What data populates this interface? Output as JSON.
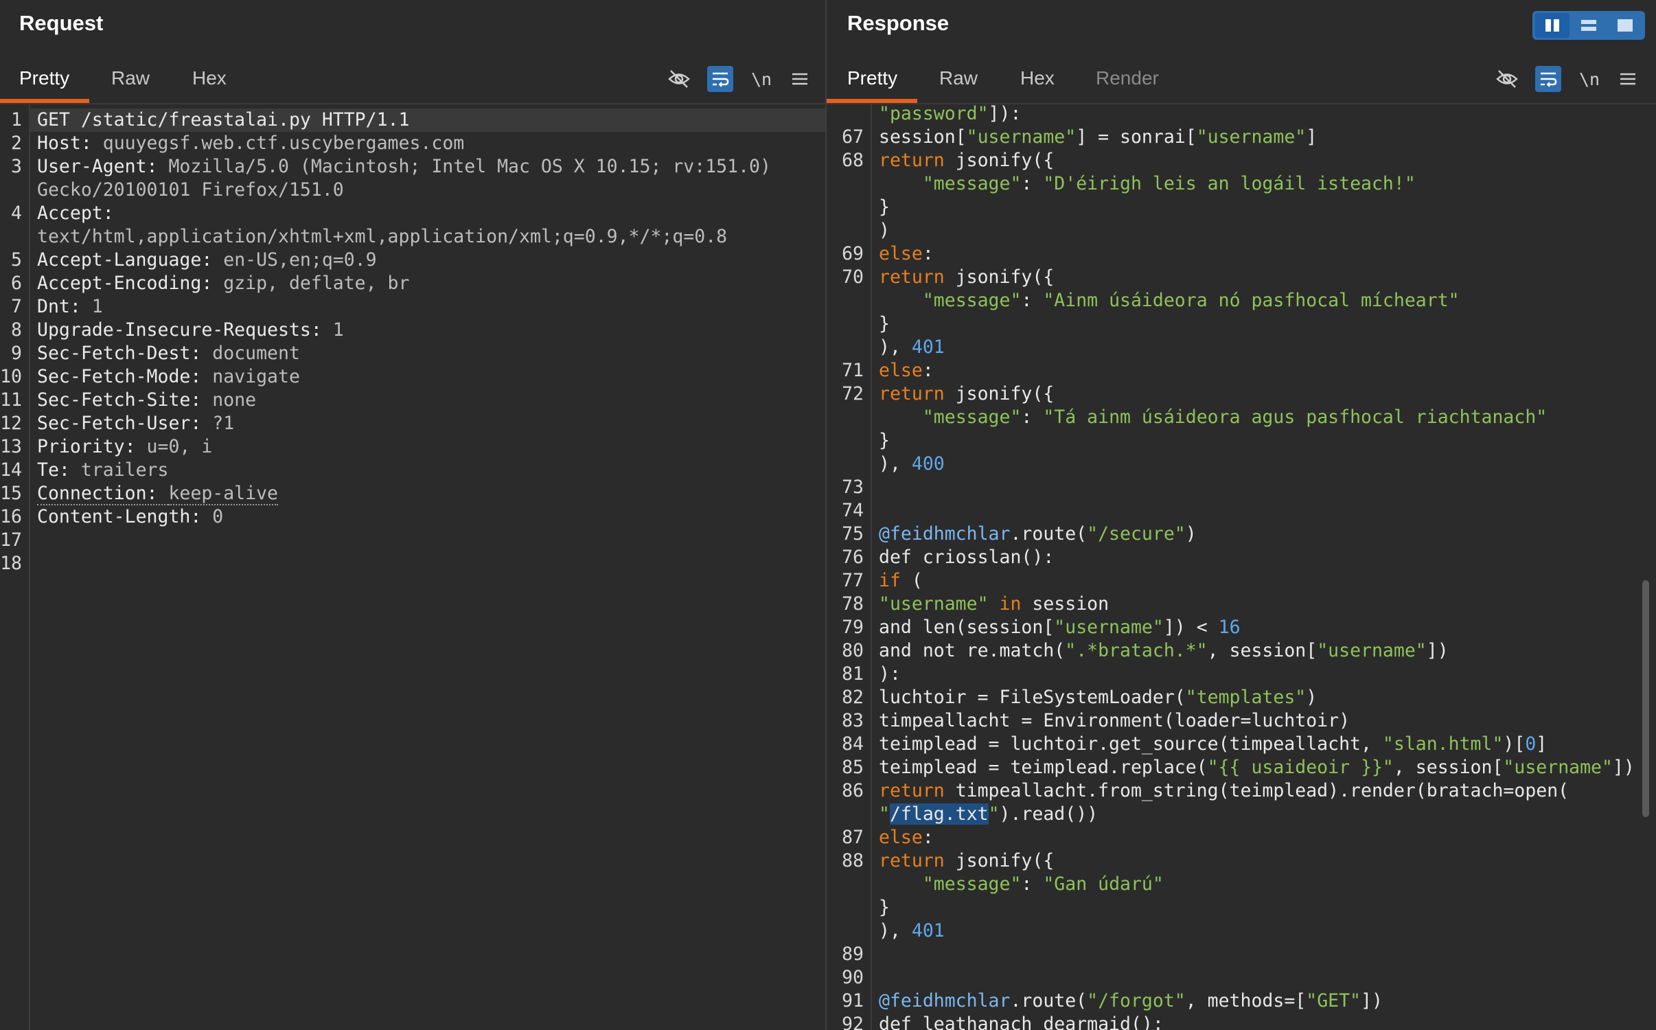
{
  "request": {
    "title": "Request",
    "tabs": [
      "Pretty",
      "Raw",
      "Hex"
    ],
    "active_tab": "Pretty",
    "lines": [
      {
        "n": "1",
        "parts": [
          [
            "plain",
            "GET /static/freastalai.py HTTP/1.1"
          ]
        ]
      },
      {
        "n": "2",
        "parts": [
          [
            "hname",
            "Host: "
          ],
          [
            "hval",
            "quuyegsf.web.ctf.uscybergames.com"
          ]
        ]
      },
      {
        "n": "3",
        "parts": [
          [
            "hname",
            "User-Agent: "
          ],
          [
            "hval",
            "Mozilla/5.0 (Macintosh; Intel Mac OS X 10.15; rv:151.0)"
          ]
        ]
      },
      {
        "n": "",
        "parts": [
          [
            "hval",
            "Gecko/20100101 Firefox/151.0"
          ]
        ]
      },
      {
        "n": "4",
        "parts": [
          [
            "hname",
            "Accept:"
          ]
        ]
      },
      {
        "n": "",
        "parts": [
          [
            "hval",
            "text/html,application/xhtml+xml,application/xml;q=0.9,*/*;q=0.8"
          ]
        ]
      },
      {
        "n": "5",
        "parts": [
          [
            "hname",
            "Accept-Language: "
          ],
          [
            "hval",
            "en-US,en;q=0.9"
          ]
        ]
      },
      {
        "n": "6",
        "parts": [
          [
            "hname",
            "Accept-Encoding: "
          ],
          [
            "hval",
            "gzip, deflate, br"
          ]
        ]
      },
      {
        "n": "7",
        "parts": [
          [
            "hname",
            "Dnt: "
          ],
          [
            "hval",
            "1"
          ]
        ]
      },
      {
        "n": "8",
        "parts": [
          [
            "hname",
            "Upgrade-Insecure-Requests: "
          ],
          [
            "hval",
            "1"
          ]
        ]
      },
      {
        "n": "9",
        "parts": [
          [
            "hname",
            "Sec-Fetch-Dest: "
          ],
          [
            "hval",
            "document"
          ]
        ]
      },
      {
        "n": "10",
        "parts": [
          [
            "hname",
            "Sec-Fetch-Mode: "
          ],
          [
            "hval",
            "navigate"
          ]
        ]
      },
      {
        "n": "11",
        "parts": [
          [
            "hname",
            "Sec-Fetch-Site: "
          ],
          [
            "hval",
            "none"
          ]
        ]
      },
      {
        "n": "12",
        "parts": [
          [
            "hname",
            "Sec-Fetch-User: "
          ],
          [
            "hval",
            "?1"
          ]
        ]
      },
      {
        "n": "13",
        "parts": [
          [
            "hname",
            "Priority: "
          ],
          [
            "hval",
            "u=0, i"
          ]
        ]
      },
      {
        "n": "14",
        "parts": [
          [
            "hname",
            "Te: "
          ],
          [
            "hval",
            "trailers"
          ]
        ]
      },
      {
        "n": "15",
        "parts": [
          [
            "hname ul",
            "Connection: "
          ],
          [
            "hval ul",
            "keep-alive"
          ]
        ]
      },
      {
        "n": "16",
        "parts": [
          [
            "hname",
            "Content-Length: "
          ],
          [
            "hval",
            "0"
          ]
        ]
      },
      {
        "n": "17",
        "parts": []
      },
      {
        "n": "18",
        "parts": []
      }
    ]
  },
  "response": {
    "title": "Response",
    "tabs": [
      "Pretty",
      "Raw",
      "Hex",
      "Render"
    ],
    "active_tab": "Pretty",
    "lines": [
      {
        "n": "",
        "parts": [
          [
            "str",
            "\"password\""
          ],
          [
            "plain",
            "]):"
          ]
        ]
      },
      {
        "n": "67",
        "parts": [
          [
            "plain",
            "session["
          ],
          [
            "str",
            "\"username\""
          ],
          [
            "plain",
            "] = sonrai["
          ],
          [
            "str",
            "\"username\""
          ],
          [
            "plain",
            "]"
          ]
        ]
      },
      {
        "n": "68",
        "parts": [
          [
            "kw",
            "return"
          ],
          [
            "plain",
            " jsonify({"
          ]
        ]
      },
      {
        "n": "",
        "parts": [
          [
            "plain",
            "    "
          ],
          [
            "str",
            "\"message\""
          ],
          [
            "plain",
            ": "
          ],
          [
            "str",
            "\"D'éirigh leis an logáil isteach!\""
          ]
        ]
      },
      {
        "n": "",
        "parts": [
          [
            "plain",
            "}"
          ]
        ]
      },
      {
        "n": "",
        "parts": [
          [
            "plain",
            ")"
          ]
        ]
      },
      {
        "n": "69",
        "parts": [
          [
            "kw",
            "else"
          ],
          [
            "plain",
            ":"
          ]
        ]
      },
      {
        "n": "70",
        "parts": [
          [
            "kw",
            "return"
          ],
          [
            "plain",
            " jsonify({"
          ]
        ]
      },
      {
        "n": "",
        "parts": [
          [
            "plain",
            "    "
          ],
          [
            "str",
            "\"message\""
          ],
          [
            "plain",
            ": "
          ],
          [
            "str",
            "\"Ainm úsáideora nó pasfhocal mícheart\""
          ]
        ]
      },
      {
        "n": "",
        "parts": [
          [
            "plain",
            "}"
          ]
        ]
      },
      {
        "n": "",
        "parts": [
          [
            "plain",
            "), "
          ],
          [
            "num",
            "401"
          ]
        ]
      },
      {
        "n": "71",
        "parts": [
          [
            "kw",
            "else"
          ],
          [
            "plain",
            ":"
          ]
        ]
      },
      {
        "n": "72",
        "parts": [
          [
            "kw",
            "return"
          ],
          [
            "plain",
            " jsonify({"
          ]
        ]
      },
      {
        "n": "",
        "parts": [
          [
            "plain",
            "    "
          ],
          [
            "str",
            "\"message\""
          ],
          [
            "plain",
            ": "
          ],
          [
            "str",
            "\"Tá ainm úsáideora agus pasfhocal riachtanach\""
          ]
        ]
      },
      {
        "n": "",
        "parts": [
          [
            "plain",
            "}"
          ]
        ]
      },
      {
        "n": "",
        "parts": [
          [
            "plain",
            "), "
          ],
          [
            "num",
            "400"
          ]
        ]
      },
      {
        "n": "73",
        "parts": []
      },
      {
        "n": "74",
        "parts": []
      },
      {
        "n": "75",
        "parts": [
          [
            "dec",
            "@feidhmchlar"
          ],
          [
            "plain",
            ".route("
          ],
          [
            "str",
            "\"/secure\""
          ],
          [
            "plain",
            ")"
          ]
        ]
      },
      {
        "n": "76",
        "parts": [
          [
            "plain",
            "def criosslan():"
          ]
        ]
      },
      {
        "n": "77",
        "parts": [
          [
            "kw",
            "if"
          ],
          [
            "plain",
            " ("
          ]
        ]
      },
      {
        "n": "78",
        "parts": [
          [
            "str",
            "\"username\""
          ],
          [
            "plain",
            " "
          ],
          [
            "kw",
            "in"
          ],
          [
            "plain",
            " session"
          ]
        ]
      },
      {
        "n": "79",
        "parts": [
          [
            "plain",
            "and len(session["
          ],
          [
            "str",
            "\"username\""
          ],
          [
            "plain",
            "]) < "
          ],
          [
            "num",
            "16"
          ]
        ]
      },
      {
        "n": "80",
        "parts": [
          [
            "plain",
            "and not re.match("
          ],
          [
            "str",
            "\".*bratach.*\""
          ],
          [
            "plain",
            ", session["
          ],
          [
            "str",
            "\"username\""
          ],
          [
            "plain",
            "])"
          ]
        ]
      },
      {
        "n": "81",
        "parts": [
          [
            "plain",
            "):"
          ]
        ]
      },
      {
        "n": "82",
        "parts": [
          [
            "plain",
            "luchtoir = FileSystemLoader("
          ],
          [
            "str",
            "\"templates\""
          ],
          [
            "plain",
            ")"
          ]
        ]
      },
      {
        "n": "83",
        "parts": [
          [
            "plain",
            "timpeallacht = Environment(loader=luchtoir)"
          ]
        ]
      },
      {
        "n": "84",
        "parts": [
          [
            "plain",
            "teimplead = luchtoir.get_source(timpeallacht, "
          ],
          [
            "str",
            "\"slan.html\""
          ],
          [
            "plain",
            ")["
          ],
          [
            "num",
            "0"
          ],
          [
            "plain",
            "]"
          ]
        ]
      },
      {
        "n": "85",
        "parts": [
          [
            "plain",
            "teimplead = teimplead.replace("
          ],
          [
            "str",
            "\"{{ usaideoir }}\""
          ],
          [
            "plain",
            ", session["
          ],
          [
            "str",
            "\"username\""
          ],
          [
            "plain",
            "])"
          ]
        ]
      },
      {
        "n": "86",
        "parts": [
          [
            "kw",
            "return"
          ],
          [
            "plain",
            " timpeallacht.from_string(teimplead).render(bratach=open("
          ]
        ]
      },
      {
        "n": "",
        "parts": [
          [
            "str",
            "\""
          ],
          [
            "sel",
            "/flag.txt"
          ],
          [
            "str",
            "\""
          ],
          [
            "plain",
            ").read())"
          ]
        ]
      },
      {
        "n": "87",
        "parts": [
          [
            "kw",
            "else"
          ],
          [
            "plain",
            ":"
          ]
        ]
      },
      {
        "n": "88",
        "parts": [
          [
            "kw",
            "return"
          ],
          [
            "plain",
            " jsonify({"
          ]
        ]
      },
      {
        "n": "",
        "parts": [
          [
            "plain",
            "    "
          ],
          [
            "str",
            "\"message\""
          ],
          [
            "plain",
            ": "
          ],
          [
            "str",
            "\"Gan údarú\""
          ]
        ]
      },
      {
        "n": "",
        "parts": [
          [
            "plain",
            "}"
          ]
        ]
      },
      {
        "n": "",
        "parts": [
          [
            "plain",
            "), "
          ],
          [
            "num",
            "401"
          ]
        ]
      },
      {
        "n": "89",
        "parts": []
      },
      {
        "n": "90",
        "parts": []
      },
      {
        "n": "91",
        "parts": [
          [
            "dec",
            "@feidhmchlar"
          ],
          [
            "plain",
            ".route("
          ],
          [
            "str",
            "\"/forgot\""
          ],
          [
            "plain",
            ", methods=["
          ],
          [
            "str",
            "\"GET\""
          ],
          [
            "plain",
            "])"
          ]
        ]
      },
      {
        "n": "92",
        "parts": [
          [
            "plain",
            "def leathanach_dearmaid():"
          ]
        ]
      }
    ]
  },
  "toolbar_icons": [
    "eye-slash-icon",
    "wrap-icon",
    "newline-toggle",
    "menu-icon"
  ],
  "newline_label": "\\n",
  "colors": {
    "accent": "#e8601c",
    "active_blue": "#2f6fb0",
    "keyword": "#e8801e",
    "string": "#8fc25a",
    "number": "#5fa8ea"
  }
}
